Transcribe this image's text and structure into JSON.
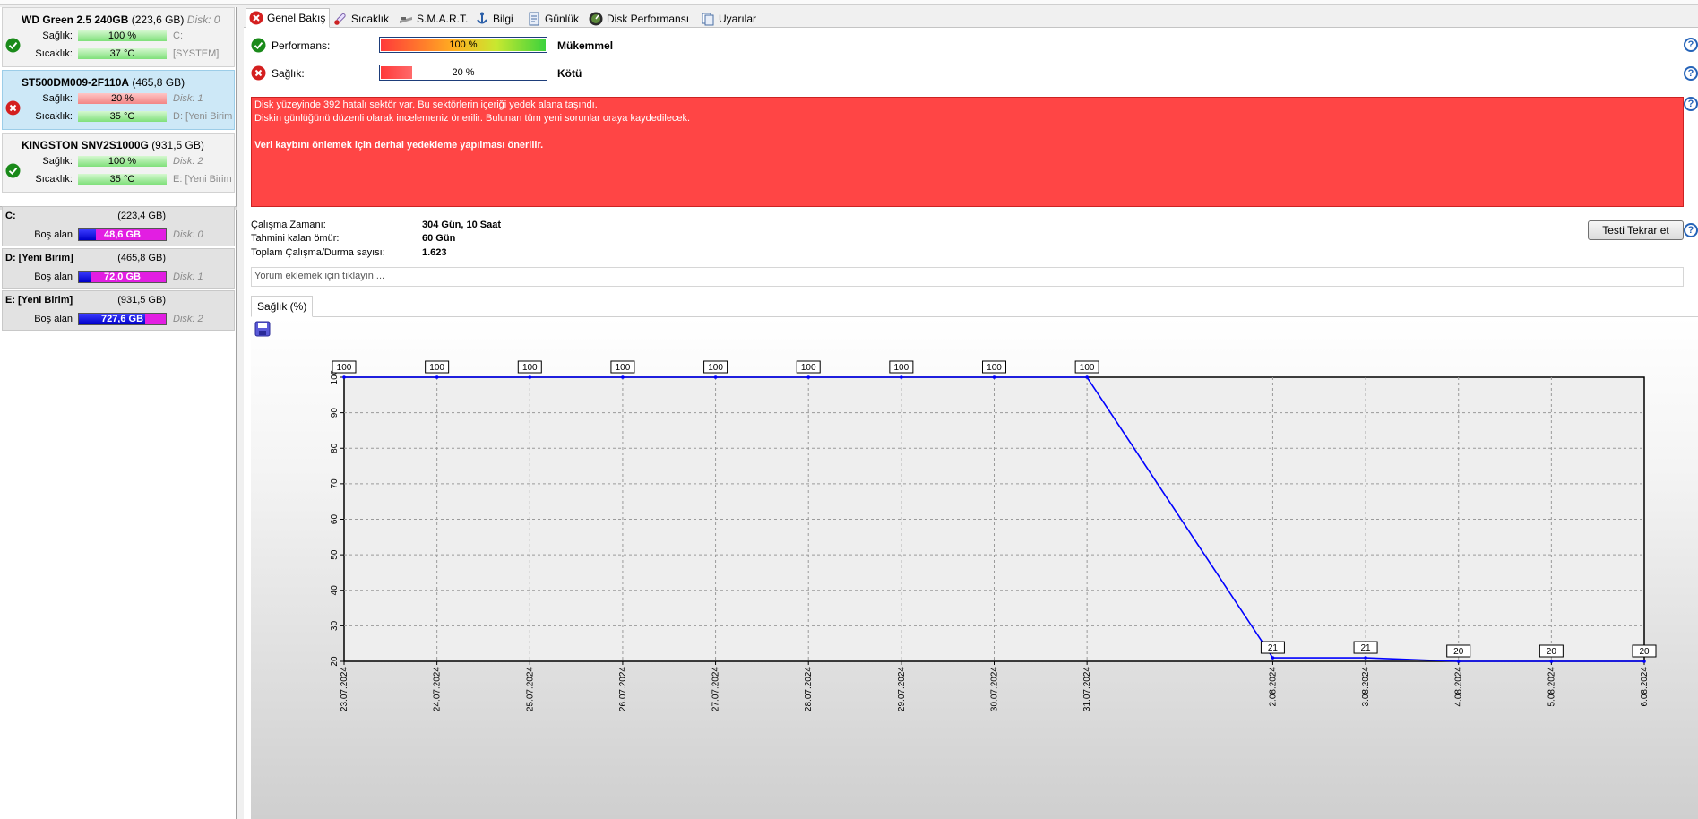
{
  "disks": [
    {
      "name": "WD Green 2.5 240GB",
      "size": "(223,6 GB)",
      "disk": "Disk: 0",
      "status": "ok",
      "health_label": "Sağlık:",
      "health": "100 %",
      "health_color": "green",
      "temp_label": "Sıcaklık:",
      "temp": "37 °C",
      "health_extra": "C:",
      "temp_extra": "[SYSTEM]"
    },
    {
      "name": "ST500DM009-2F110A",
      "size": "(465,8 GB)",
      "disk": "Disk: 1",
      "status": "error",
      "health_label": "Sağlık:",
      "health": "20 %",
      "health_color": "red",
      "temp_label": "Sıcaklık:",
      "temp": "35 °C",
      "health_extra": "Disk: 1",
      "temp_extra": "D: [Yeni Birim"
    },
    {
      "name": "KINGSTON SNV2S1000G",
      "size": "(931,5 GB)",
      "disk": "Disk: 2",
      "status": "ok",
      "health_label": "Sağlık:",
      "health": "100 %",
      "health_color": "green",
      "temp_label": "Sıcaklık:",
      "temp": "35 °C",
      "health_extra": "Disk: 2",
      "temp_extra": "E: [Yeni Birim"
    }
  ],
  "volumes": [
    {
      "name": "C:",
      "size": "(223,4 GB)",
      "free_label": "Boş alan",
      "free": "48,6 GB",
      "free_fraction": 0.22,
      "disk": "Disk: 0"
    },
    {
      "name": "D: [Yeni Birim]",
      "size": "(465,8 GB)",
      "free_label": "Boş alan",
      "free": "72,0 GB",
      "free_fraction": 0.15,
      "disk": "Disk: 1"
    },
    {
      "name": "E: [Yeni Birim]",
      "size": "(931,5 GB)",
      "free_label": "Boş alan",
      "free": "727,6 GB",
      "free_fraction": 0.78,
      "disk": "Disk: 2"
    }
  ],
  "tabs": [
    {
      "label": "Genel Bakış",
      "icon": "error-icon",
      "active": true
    },
    {
      "label": "Sıcaklık",
      "icon": "thermometer-icon"
    },
    {
      "label": "S.M.A.R.T.",
      "icon": "smart-icon"
    },
    {
      "label": "Bilgi",
      "icon": "info-icon"
    },
    {
      "label": "Günlük",
      "icon": "log-icon"
    },
    {
      "label": "Disk Performansı",
      "icon": "performance-icon"
    },
    {
      "label": "Uyarılar",
      "icon": "alerts-icon"
    }
  ],
  "overview": {
    "performance_label": "Performans:",
    "performance_value": "100 %",
    "performance_fraction": 1.0,
    "performance_word": "Mükemmel",
    "health_label": "Sağlık:",
    "health_value": "20 %",
    "health_fraction": 0.2,
    "health_word": "Kötü",
    "alert_line1": "Disk yüzeyinde 392 hatalı sektör var. Bu sektörlerin içeriği yedek alana taşındı.",
    "alert_line2": "Diskin günlüğünü düzenli olarak incelemeniz önerilir. Bulunan tüm yeni sorunlar oraya kaydedilecek.",
    "alert_line3": "Veri kaybını önlemek için derhal yedekleme yapılması önerilir.",
    "uptime_label": "Çalışma Zamanı:",
    "uptime_value": "304 Gün, 10 Saat",
    "life_label": "Tahmini kalan ömür:",
    "life_value": "60 Gün",
    "cycles_label": "Toplam Çalışma/Durma sayısı:",
    "cycles_value": "1.623",
    "retest_button": "Testi Tekrar et",
    "comment_placeholder": "Yorum eklemek için tıklayın ...",
    "chart_tab": "Sağlık (%)"
  },
  "colors": {
    "alert_bg": "#ff4545",
    "series": "#0000ff",
    "selected_row": "#cde8f7"
  },
  "chart_data": {
    "type": "line",
    "x": [
      "23.07.2024",
      "24.07.2024",
      "25.07.2024",
      "26.07.2024",
      "27.07.2024",
      "28.07.2024",
      "29.07.2024",
      "30.07.2024",
      "31.07.2024",
      "2.08.2024",
      "3.08.2024",
      "4.08.2024",
      "5.08.2024",
      "6.08.2024"
    ],
    "series": [
      {
        "values": [
          100,
          100,
          100,
          100,
          100,
          100,
          100,
          100,
          100,
          21,
          21,
          20,
          20,
          20
        ]
      }
    ],
    "yticks": [
      20,
      30,
      40,
      50,
      60,
      70,
      80,
      90,
      100
    ],
    "ylim": [
      20,
      100
    ],
    "grid": true,
    "data_labels": true,
    "time_axis": true
  }
}
